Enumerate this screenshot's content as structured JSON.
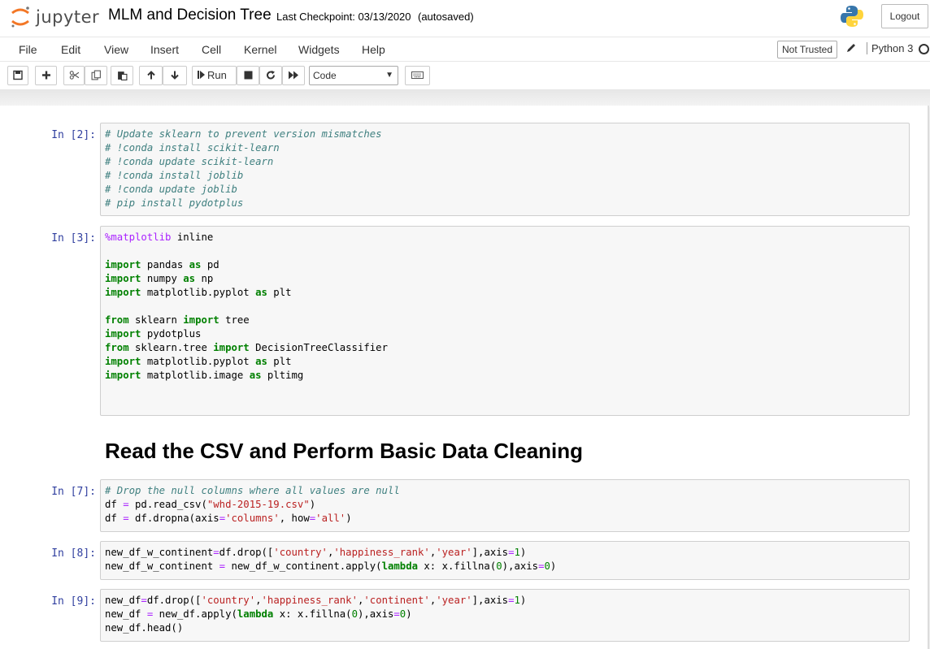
{
  "header": {
    "logo_text": "jupyter",
    "notebook_title": "MLM and Decision Tree",
    "checkpoint": "Last Checkpoint: 03/13/2020",
    "autosave": "(autosaved)",
    "logout_label": "Logout"
  },
  "menubar": {
    "items": [
      "File",
      "Edit",
      "View",
      "Insert",
      "Cell",
      "Kernel",
      "Widgets",
      "Help"
    ],
    "trust_label": "Not Trusted",
    "kernel_name": "Python 3"
  },
  "toolbar": {
    "run_label": "Run",
    "cell_type": "Code"
  },
  "colors": {
    "prompt": "#303f9f",
    "comment": "#408080",
    "keyword": "#008000",
    "string": "#ba2121",
    "number": "#008000",
    "magic": "#aa22ff",
    "cell_bg": "#f7f7f7"
  },
  "cells": [
    {
      "prompt": "In [2]:",
      "lines": [
        "# Update sklearn to prevent version mismatches",
        "# !conda install scikit-learn",
        "# !conda update scikit-learn",
        "# !conda install joblib",
        "# !conda update joblib",
        "# pip install pydotplus"
      ]
    },
    {
      "prompt": "In [3]:",
      "lines": [
        "%matplotlib inline",
        "",
        "import pandas as pd",
        "import numpy as np",
        "import matplotlib.pyplot as plt",
        "",
        "from sklearn import tree",
        "import pydotplus",
        "from sklearn.tree import DecisionTreeClassifier",
        "import matplotlib.pyplot as plt",
        "import matplotlib.image as pltimg"
      ]
    },
    {
      "markdown_heading": "Read the CSV and Perform Basic Data Cleaning"
    },
    {
      "prompt": "In [7]:",
      "lines": [
        "# Drop the null columns where all values are null",
        "df = pd.read_csv(\"whd-2015-19.csv\")",
        "df = df.dropna(axis='columns', how='all')"
      ]
    },
    {
      "prompt": "In [8]:",
      "lines": [
        "new_df_w_continent=df.drop(['country','happiness_rank','year'],axis=1)",
        "new_df_w_continent = new_df_w_continent.apply(lambda x: x.fillna(0),axis=0)"
      ]
    },
    {
      "prompt": "In [9]:",
      "lines": [
        "new_df=df.drop(['country','happiness_rank','continent','year'],axis=1)",
        "new_df = new_df.apply(lambda x: x.fillna(0),axis=0)",
        "new_df.head()"
      ]
    }
  ]
}
